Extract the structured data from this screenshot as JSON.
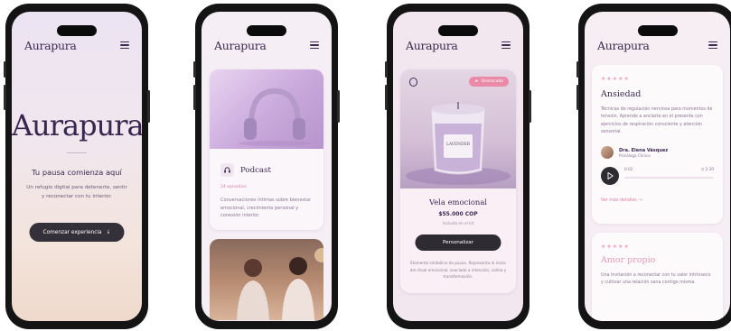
{
  "brand": "Aurapura",
  "screen1": {
    "hero_logo": "Aurapura",
    "tagline": "Tu pausa comienza aquí",
    "subline": "Un refugio digital para detenerte, sentir y reconectar con tu interior.",
    "cta_label": "Comenzar experiencia",
    "cta_icon": "arrow-down-icon"
  },
  "screen2": {
    "card_title": "Podcast",
    "card_icon": "headphones-icon",
    "episodes": "24 episodios",
    "description": "Conversaciones íntimas sobre bienestar emocional, crecimiento personal y conexión interior."
  },
  "screen3": {
    "badge": "Destacado",
    "product_label": "LAVENDER",
    "product_name": "Vela emocional",
    "price": "$55.000 COP",
    "note": "Incluida en el kit",
    "button": "Personalizar",
    "description": "Elemento simbólico de pausa. Representa el inicio del ritual emocional, asociado a intención, calma y transformación."
  },
  "screen4": {
    "rating": "★★★★★",
    "title": "Ansiedad",
    "description": "Técnicas de regulación nerviosa para momentos de tensión. Aprende a anclarte en el presente con ejercicios de respiración consciente y atención sensorial.",
    "author_name": "Dra. Elena Vásquez",
    "author_role": "Psicóloga Clínica",
    "time_start": "0:02",
    "time_end": "2:30",
    "more_link": "Ver más detalles",
    "rating2": "★★★★★",
    "title2": "Amor propio",
    "description2": "Una invitación a reconectar con tu valor intrínseco y cultivar una relación sana contigo misma."
  },
  "colors": {
    "primary": "#3d2a52",
    "accent": "#eb8aa8",
    "button": "#2f2b33"
  }
}
